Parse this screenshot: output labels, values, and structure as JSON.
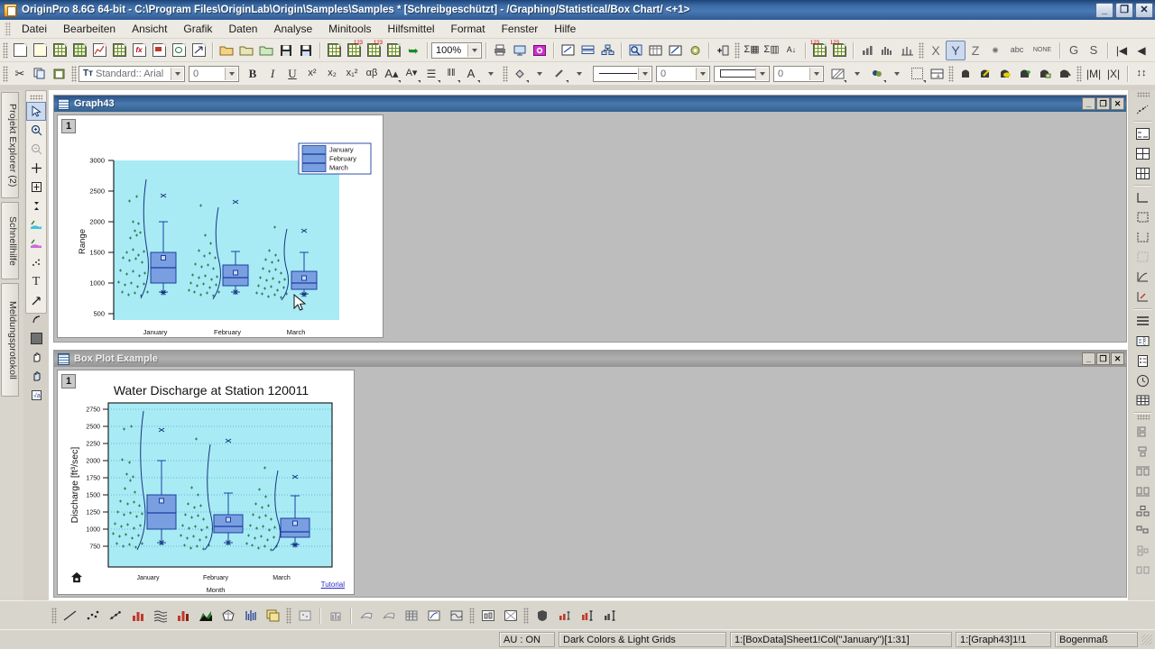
{
  "window": {
    "title": "OriginPro 8.6G 64-bit - C:\\Program Files\\OriginLab\\Origin\\Samples\\Samples * [Schreibgeschützt] - /Graphing/Statistical/Box Chart/ <+1>",
    "minimize_label": "_",
    "maximize_label": "❐",
    "close_label": "✕",
    "app_icon": "origin-app-icon"
  },
  "menubar": {
    "items": [
      {
        "label": "Datei"
      },
      {
        "label": "Bearbeiten"
      },
      {
        "label": "Ansicht"
      },
      {
        "label": "Grafik"
      },
      {
        "label": "Daten"
      },
      {
        "label": "Analyse"
      },
      {
        "label": "Minitools"
      },
      {
        "label": "Hilfsmittel"
      },
      {
        "label": "Format"
      },
      {
        "label": "Fenster"
      },
      {
        "label": "Hilfe"
      }
    ]
  },
  "toolbar_standard": {
    "zoom_value": "100%",
    "buttons": [
      "new-project-icon",
      "new-folder-icon",
      "new-workbook-icon",
      "new-excel-icon",
      "new-graph-icon",
      "new-matrix-icon",
      "new-function-icon",
      "new-layout-icon",
      "new-notes-icon",
      "new-export-icon",
      "open-icon",
      "open-excel-icon",
      "open-template-icon",
      "save-project-icon",
      "save-template-icon",
      "import-wizard-icon",
      "import-single-ascii-icon",
      "import-multiple-ascii-icon",
      "duplicate-icon",
      "refresh-icon",
      "print-icon",
      "print-preview-icon",
      "copy-page-icon",
      "project-explorer-icon",
      "results-log-icon",
      "layer-manager-icon",
      "code-builder-icon",
      "command-window-icon",
      "script-window-icon",
      "gear-icon",
      "add-layer-icon",
      "statistics-columns-icon",
      "statistics-rows-icon",
      "sort-icon",
      "set-column-values-icon",
      "set-matrix-values-icon",
      "plot-bar-icon",
      "plot-histogram-icon",
      "plot-stack-icon",
      "set-as-x-icon",
      "set-as-y-icon",
      "set-as-z-icon",
      "set-as-error-icon",
      "set-as-label-icon",
      "set-as-none-icon",
      "group-icon",
      "sort-worksheet-icon",
      "first-icon",
      "previous-icon"
    ]
  },
  "toolbar_format": {
    "font_value": "Standard:: Arial",
    "size_value": "0",
    "line_width_value": "0",
    "fill_value": "0",
    "buttons": [
      "cut-icon",
      "copy-icon",
      "paste-icon",
      "bold-icon",
      "italic-icon",
      "underline-icon",
      "superscript-icon",
      "subscript-icon",
      "super-subscript-icon",
      "greek-icon",
      "increase-font-icon",
      "decrease-font-icon",
      "justify-icon",
      "ruler-icon",
      "font-color-icon",
      "fill-color-icon",
      "line-color-icon",
      "line-style-icon",
      "pattern-icon",
      "pattern-color-icon",
      "transparency-icon",
      "merge-cells-icon",
      "heatmap-icon",
      "lock-icon",
      "edit-mode-icon",
      "speed-mode-icon",
      "rescale-icon",
      "layer-contents-icon",
      "mask-icon",
      "merge-graph-icon",
      "exchange-xy-icon",
      "vertical-align-icon",
      "horizontal-align-icon"
    ]
  },
  "left_panels": {
    "tabs": [
      {
        "label": "Projekt Explorer (2)"
      },
      {
        "label": "Schnellhilfe"
      },
      {
        "label": "Meldungsprotokoll"
      }
    ]
  },
  "tools_palette": {
    "items": [
      "pointer-icon",
      "zoom-in-icon",
      "zoom-out-icon",
      "data-reader-icon",
      "screen-reader-icon",
      "data-selector-icon",
      "data-highlighter-icon",
      "regional-mask-icon",
      "scatter-mask-icon",
      "text-tool-icon",
      "arrow-tool-icon",
      "curved-arrow-icon",
      "rectangle-tool-icon",
      "pan-icon",
      "pan-x-icon",
      "equation-icon"
    ],
    "selected": "pointer-icon"
  },
  "right_palette": {
    "items": [
      "scale-in-icon",
      "two-panel-icon",
      "four-panel-icon",
      "six-panel-icon",
      "axis-bottom-left-icon",
      "axis-box-icon",
      "axis-frame-icon",
      "axis-none-icon",
      "axis-log-icon",
      "axis-color-icon",
      "layers-stack-icon",
      "legend-icon",
      "grid-table-icon",
      "clock-icon",
      "table-icon",
      "align-left-icon",
      "align-center-icon",
      "align-top-icon",
      "align-bottom-icon",
      "distribute-h-icon",
      "distribute-v-icon",
      "group-objects-icon",
      "ungroup-objects-icon"
    ]
  },
  "graph_windows": [
    {
      "title": "Graph43",
      "active": true,
      "layer_label": "1",
      "minimize_label": "_",
      "maximize_label": "❐",
      "close_label": "✕",
      "chart_index": 0
    },
    {
      "title": "Box Plot Example",
      "active": false,
      "layer_label": "1",
      "minimize_label": "_",
      "maximize_label": "❐",
      "close_label": "✕",
      "tutorial_link": "Tutorial",
      "home_icon": "home-icon",
      "chart_index": 1
    }
  ],
  "chart_data": [
    {
      "type": "box",
      "title": "",
      "xlabel": "",
      "ylabel": "Range",
      "categories": [
        "January",
        "February",
        "March"
      ],
      "ylim": [
        350,
        3000
      ],
      "yticks": [
        500,
        1000,
        1500,
        2000,
        2500,
        3000
      ],
      "grid": false,
      "plot_bg": "#a8ebf5",
      "box_fill": "#7a9fe0",
      "box_line": "#1b3fa0",
      "scatter_color": "#2e7d4f",
      "legend": {
        "position": "top-right",
        "entries": [
          "January",
          "February",
          "March"
        ]
      },
      "series": [
        {
          "name": "January",
          "min": 800,
          "q1": 1000,
          "median": 1225,
          "q3": 1440,
          "max": 2000,
          "mean": 1300,
          "outliers": [
            2410,
            805
          ]
        },
        {
          "name": "February",
          "min": 830,
          "q1": 960,
          "median": 1065,
          "q3": 1220,
          "max": 1535,
          "mean": 1145,
          "outliers": [
            2300,
            820
          ]
        },
        {
          "name": "March",
          "min": 790,
          "q1": 905,
          "median": 975,
          "q3": 1160,
          "max": 1470,
          "mean": 1045,
          "outliers": [
            1790,
            780
          ]
        }
      ]
    },
    {
      "type": "box",
      "title": "Water Discharge at Station 120011",
      "xlabel": "Month",
      "ylabel": "Discharge [ft³/sec]",
      "categories": [
        "January",
        "February",
        "March"
      ],
      "ylim": [
        620,
        2900
      ],
      "yticks": [
        750,
        1000,
        1250,
        1500,
        1750,
        2000,
        2250,
        2500,
        2750
      ],
      "grid": true,
      "plot_bg": "#a8ebf5",
      "box_fill": "#7a9fe0",
      "box_line": "#1b3fa0",
      "scatter_color": "#2e7d4f",
      "legend": null,
      "series": [
        {
          "name": "January",
          "min": 810,
          "q1": 1000,
          "median": 1235,
          "q3": 1450,
          "max": 2005,
          "mean": 1300,
          "outliers": [
            2400,
            810
          ]
        },
        {
          "name": "February",
          "min": 820,
          "q1": 955,
          "median": 1070,
          "q3": 1215,
          "max": 1540,
          "mean": 1150,
          "outliers": [
            2300,
            815
          ]
        },
        {
          "name": "March",
          "min": 780,
          "q1": 885,
          "median": 960,
          "q3": 1165,
          "max": 1480,
          "mean": 1050,
          "outliers": [
            1780,
            780
          ]
        }
      ]
    }
  ],
  "bottom_toolbar": {
    "buttons": [
      "line-plot-icon",
      "scatter-plot-icon",
      "line-symbol-icon",
      "column-plot-icon",
      "stack-lines-icon",
      "bar-3d-icon",
      "area-plot-icon",
      "polar-plot-icon",
      "high-low-close-icon",
      "multi-panel-icon",
      "surface-3d-icon",
      "bar-3d-color-icon",
      "wire-surface-icon",
      "color-fill-surface-icon",
      "mesh-icon",
      "contour-icon",
      "image-plot-icon",
      "box-chart-icon",
      "scatter-matrix-icon",
      "shield-icon",
      "error-bars-icon",
      "vertical-drop-icon",
      "column-scatter-icon"
    ]
  },
  "statusbar": {
    "auto_update": "AU : ON",
    "theme": "Dark Colors & Light Grids",
    "selection": "1:[BoxData]Sheet1!Col(\"January\")[1:31]",
    "window_ref": "1:[Graph43]1!1",
    "angle_unit": "Bogenmaß"
  }
}
